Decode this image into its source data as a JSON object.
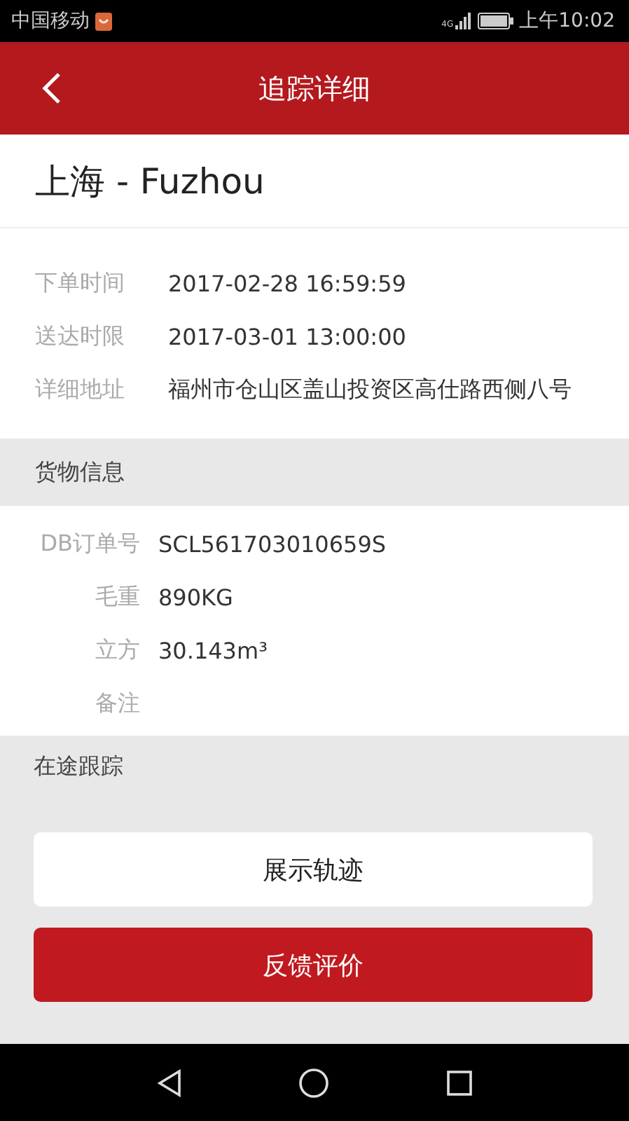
{
  "status_bar": {
    "carrier": "中国移动",
    "network": "4G",
    "time": "上午10:02"
  },
  "header": {
    "title": "追踪详细"
  },
  "route": "上海 - Fuzhou",
  "details": [
    {
      "label": "下单时间",
      "value": "2017-02-28 16:59:59"
    },
    {
      "label": "送达时限",
      "value": "2017-03-01 13:00:00"
    },
    {
      "label": "详细地址",
      "value": "福州市仓山区盖山投资区高仕路西侧八号"
    }
  ],
  "cargo": {
    "title": "货物信息",
    "rows": [
      {
        "label": "DB订单号",
        "value": "SCL561703010659S"
      },
      {
        "label": "毛重",
        "value": "890KG"
      },
      {
        "label": "立方",
        "value": "30.143m³"
      },
      {
        "label": "备注"
      }
    ]
  },
  "tracking": {
    "title": "在途跟踪"
  },
  "buttons": [
    {
      "label": "展示轨迹",
      "kind": "secondary"
    },
    {
      "label": "反馈评价",
      "kind": "primary"
    }
  ]
}
